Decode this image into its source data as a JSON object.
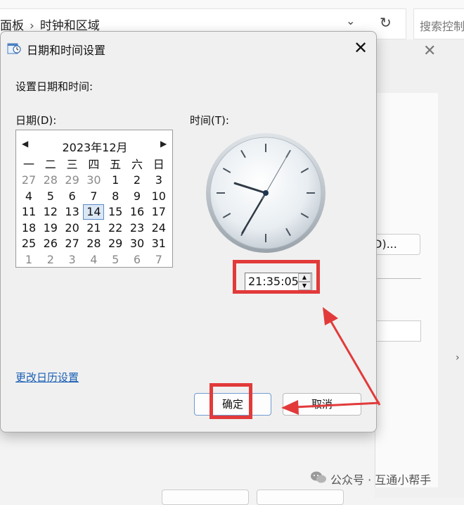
{
  "background": {
    "breadcrumb": [
      "面板",
      "时钟和区域"
    ],
    "search_placeholder": "搜索控制",
    "partial_button_label": "D)...",
    "dropdown_glyph": "⌄",
    "refresh_glyph": "↻",
    "close_glyph": "✕"
  },
  "dialog": {
    "title": "日期和时间设置",
    "close_glyph": "✕",
    "heading": "设置日期和时间:",
    "date_label": "日期(D):",
    "time_label": "时间(T):",
    "calendar": {
      "month": "2023年12月",
      "prev_glyph": "◀",
      "next_glyph": "▶",
      "weekdays": [
        "一",
        "二",
        "三",
        "四",
        "五",
        "六",
        "日"
      ],
      "weeks": [
        [
          "27",
          "28",
          "29",
          "30",
          "1",
          "2",
          "3"
        ],
        [
          "4",
          "5",
          "6",
          "7",
          "8",
          "9",
          "10"
        ],
        [
          "11",
          "12",
          "13",
          "14",
          "15",
          "16",
          "17"
        ],
        [
          "18",
          "19",
          "20",
          "21",
          "22",
          "23",
          "24"
        ],
        [
          "25",
          "26",
          "27",
          "28",
          "29",
          "30",
          "31"
        ],
        [
          "1",
          "2",
          "3",
          "4",
          "5",
          "6",
          "7"
        ]
      ],
      "selected_day": "14"
    },
    "time_value": "21:35:05",
    "spin_up_glyph": "▲",
    "spin_down_glyph": "▼",
    "change_calendar_link": "更改日历设置",
    "ok_label": "确定",
    "cancel_label": "取消"
  },
  "annotation_color": "#e23a3a",
  "watermark": "公众号 · 互通小帮手"
}
